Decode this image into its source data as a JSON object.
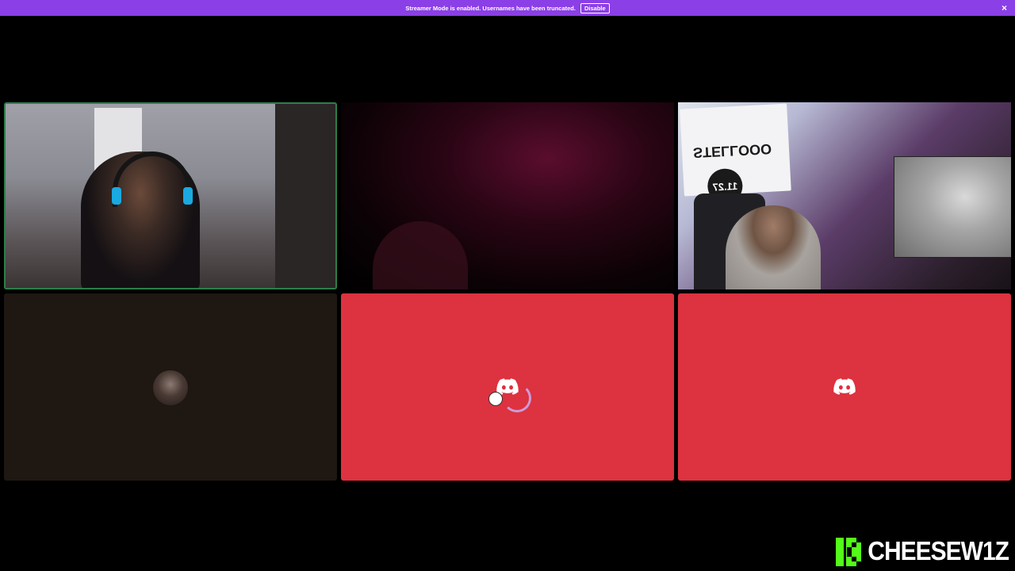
{
  "banner": {
    "message": "Streamer Mode is enabled. Usernames have been truncated.",
    "disable_label": "Disable",
    "close_glyph": "×",
    "color": "#8b3fe6"
  },
  "tiles": [
    {
      "kind": "video",
      "speaking": true
    },
    {
      "kind": "video"
    },
    {
      "kind": "video",
      "sign_text": "STELLOOO",
      "sign_number": "11.27"
    },
    {
      "kind": "avatar"
    },
    {
      "kind": "discord-logo",
      "color": "#dd323f"
    },
    {
      "kind": "discord-logo",
      "color": "#dd323f"
    }
  ],
  "watermark": {
    "platform_icon": "kick-logo-icon",
    "name": "CHEESEW1Z",
    "brand_color": "#53fc18"
  }
}
